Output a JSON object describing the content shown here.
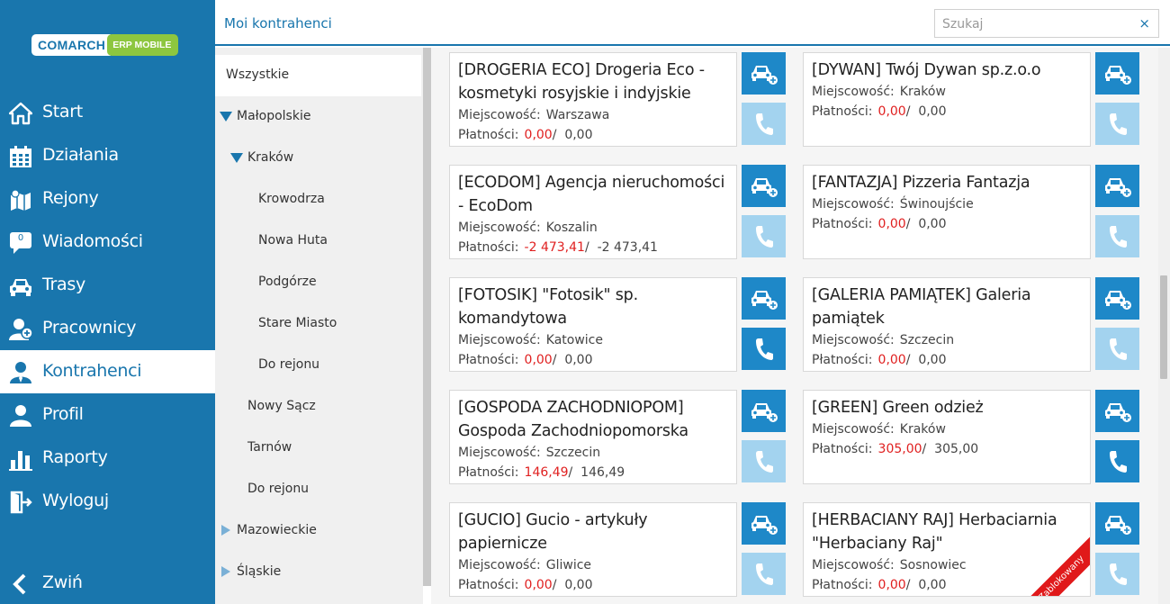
{
  "brand": {
    "left": "COMARCH",
    "right": "ERP MOBILE"
  },
  "nav": {
    "items": [
      {
        "label": "Start",
        "icon": "home-icon"
      },
      {
        "label": "Działania",
        "icon": "calendar-icon"
      },
      {
        "label": "Rejony",
        "icon": "map-icon"
      },
      {
        "label": "Wiadomości",
        "icon": "message-icon",
        "badge": "0"
      },
      {
        "label": "Trasy",
        "icon": "car-icon"
      },
      {
        "label": "Pracownicy",
        "icon": "users-icon"
      },
      {
        "label": "Kontrahenci",
        "icon": "contractor-icon",
        "active": true
      },
      {
        "label": "Profil",
        "icon": "user-icon"
      },
      {
        "label": "Raporty",
        "icon": "chart-icon"
      },
      {
        "label": "Wyloguj",
        "icon": "logout-icon"
      }
    ],
    "collapse_label": "Zwiń"
  },
  "header": {
    "title": "Moi kontrahenci",
    "search_placeholder": "Szukaj",
    "clear_glyph": "×"
  },
  "tree": [
    {
      "label": "Wszystkie",
      "selected": true
    },
    {
      "label": "Małopolskie",
      "arrow": "down"
    },
    {
      "label": "Kraków",
      "arrow": "down"
    },
    {
      "label": "Krowodrza"
    },
    {
      "label": "Nowa Huta"
    },
    {
      "label": "Podgórze"
    },
    {
      "label": "Stare Miasto"
    },
    {
      "label": "Do rejonu"
    },
    {
      "label": "Nowy Sącz"
    },
    {
      "label": "Tarnów"
    },
    {
      "label": "Do rejonu"
    },
    {
      "label": "Mazowieckie",
      "arrow": "right"
    },
    {
      "label": "Śląskie",
      "arrow": "right"
    }
  ],
  "labels": {
    "city": "Miejscowość:",
    "payments": "Płatności:"
  },
  "contractors": [
    {
      "name": "[DROGERIA ECO] Drogeria Eco - kosmetyki rosyjskie i indyjskie",
      "city": "Warszawa",
      "pay1": "0,00",
      "pay2": "0,00",
      "phone_active": false
    },
    {
      "name": "[DYWAN] Twój Dywan sp.z.o.o",
      "city": "Kraków",
      "pay1": "0,00",
      "pay2": "0,00",
      "phone_active": false
    },
    {
      "name": "[ECODOM] Agencja nieruchomości - EcoDom",
      "city": "Koszalin",
      "pay1": "-2 473,41",
      "pay2": "-2 473,41",
      "phone_active": false
    },
    {
      "name": "[FANTAZJA] Pizzeria Fantazja",
      "city": "Świnoujście",
      "pay1": "0,00",
      "pay2": "0,00",
      "phone_active": false
    },
    {
      "name": "[FOTOSIK] \"Fotosik\" sp. komandytowa",
      "city": "Katowice",
      "pay1": "0,00",
      "pay2": "0,00",
      "phone_active": true
    },
    {
      "name": "[GALERIA PAMIĄTEK] Galeria pamiątek",
      "city": "Szczecin",
      "pay1": "0,00",
      "pay2": "0,00",
      "phone_active": false
    },
    {
      "name": "[GOSPODA ZACHODNIOPOM] Gospoda Zachodniopomorska",
      "city": "Szczecin",
      "pay1": "146,49",
      "pay2": "146,49",
      "phone_active": false
    },
    {
      "name": "[GREEN] Green odzież",
      "city": "Kraków",
      "pay1": "305,00",
      "pay2": "305,00",
      "phone_active": true
    },
    {
      "name": "[GUCIO] Gucio - artykuły papiernicze",
      "city": "Gliwice",
      "pay1": "0,00",
      "pay2": "0,00",
      "phone_active": false
    },
    {
      "name": "[HERBACIANY RAJ] Herbaciarnia \"Herbaciany Raj\"",
      "city": "Sosnowiec",
      "pay1": "0,00",
      "pay2": "0,00",
      "phone_active": false,
      "blocked_label": "Zablokowany"
    }
  ],
  "colors": {
    "primary": "#1976ad",
    "button": "#1e88c8",
    "button_light": "#a3d3ef",
    "negative": "#e02020",
    "ribbon": "#e0191a"
  }
}
